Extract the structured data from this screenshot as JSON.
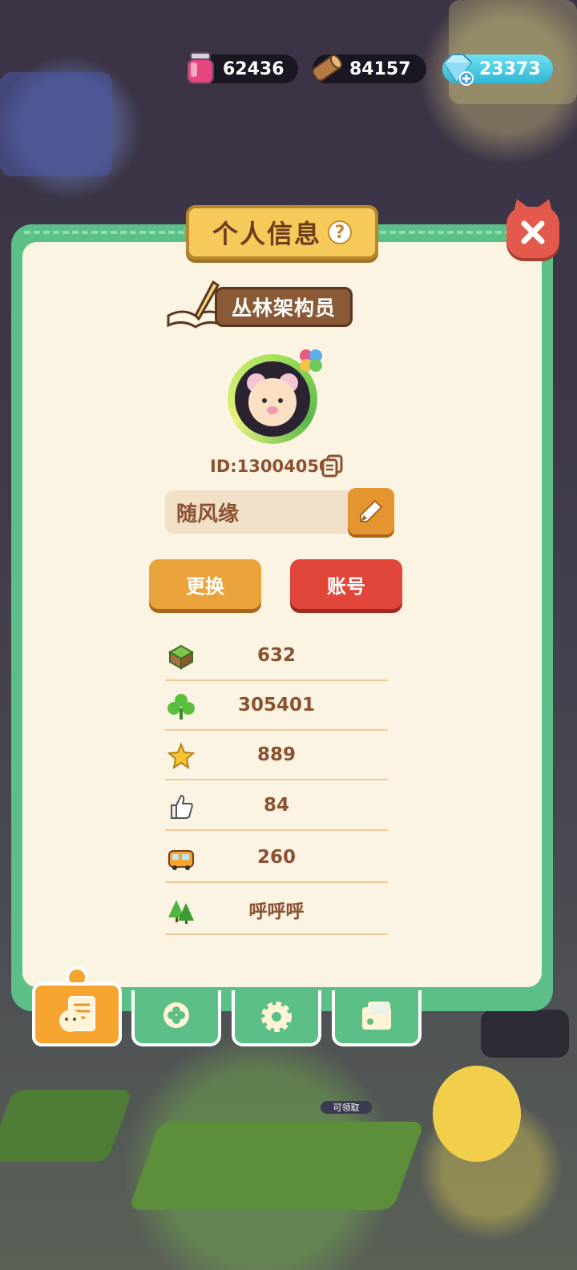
{
  "resources": {
    "ink": {
      "value": "62436",
      "icon": "ink-bottle-icon"
    },
    "wood": {
      "value": "84157",
      "icon": "wood-log-icon"
    },
    "gem": {
      "value": "23373",
      "icon": "diamond-icon"
    }
  },
  "panel": {
    "title": "个人信息",
    "help_glyph": "?",
    "close_icon": "close-icon"
  },
  "profile": {
    "rank": "丛林架构员",
    "id_text": "ID:13004050",
    "name": "随风缘"
  },
  "buttons": {
    "change_label": "更换",
    "account_label": "账号"
  },
  "stats": [
    {
      "icon": "grass-block-icon",
      "value": "632"
    },
    {
      "icon": "clover-icon",
      "value": "305401"
    },
    {
      "icon": "star-icon",
      "value": "889"
    },
    {
      "icon": "thumbs-up-icon",
      "value": "84"
    },
    {
      "icon": "bus-icon",
      "value": "260"
    },
    {
      "icon": "trees-icon",
      "value": "呼呼呼"
    }
  ],
  "tabs": [
    {
      "name": "profile",
      "icon": "profile-card-icon",
      "active": true
    },
    {
      "name": "badges",
      "icon": "clover-badge-icon",
      "active": false
    },
    {
      "name": "settings",
      "icon": "gear-icon",
      "active": false
    },
    {
      "name": "album",
      "icon": "photo-folder-icon",
      "active": false
    }
  ],
  "world": {
    "claim_label": "可领取"
  },
  "colors": {
    "panel_green": "#5cbf87",
    "panel_cream": "#fbf4e3",
    "text_brown": "#8b5131",
    "orange_button": "#eaa33c",
    "red_button": "#e2463b",
    "close_red": "#e35a4d"
  }
}
